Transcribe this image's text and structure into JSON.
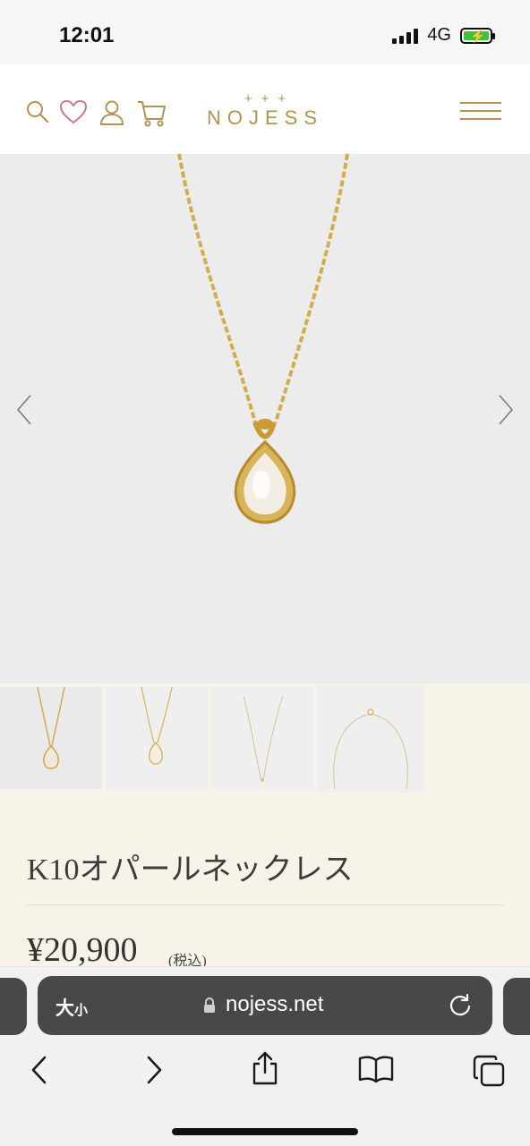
{
  "status_bar": {
    "time": "12:01",
    "network": "4G",
    "battery_charging": true,
    "battery_level": 1.0
  },
  "header": {
    "logo_crosses": "+++",
    "logo_text": "NOJESS"
  },
  "hero": {
    "prev_icon": "chevron-left-icon",
    "next_icon": "chevron-right-icon"
  },
  "thumbnails": [
    {
      "name": "necklace-front"
    },
    {
      "name": "necklace-worn"
    },
    {
      "name": "necklace-full"
    },
    {
      "name": "necklace-clasp"
    }
  ],
  "product": {
    "title": "K10オパールネックレス",
    "price": "¥20,900",
    "tax_note": "(税込)"
  },
  "browser": {
    "text_size_large": "大",
    "text_size_small": "小",
    "url": "nojess.net"
  },
  "colors": {
    "brand": "#b49252",
    "page_bg": "#f7f3e8",
    "url_bar": "#4a4846"
  }
}
